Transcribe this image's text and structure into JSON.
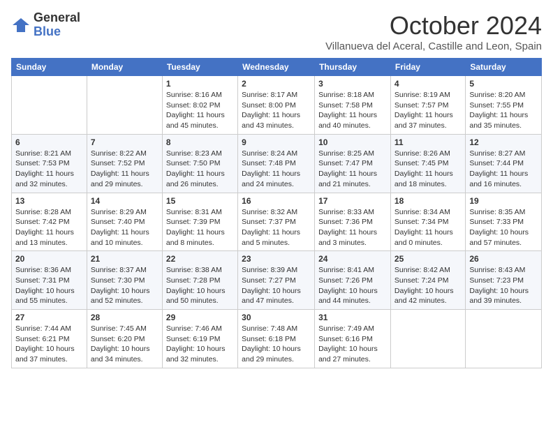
{
  "logo": {
    "general": "General",
    "blue": "Blue"
  },
  "title": "October 2024",
  "location": "Villanueva del Aceral, Castille and Leon, Spain",
  "weekdays": [
    "Sunday",
    "Monday",
    "Tuesday",
    "Wednesday",
    "Thursday",
    "Friday",
    "Saturday"
  ],
  "weeks": [
    [
      {
        "day": "",
        "sunrise": "",
        "sunset": "",
        "daylight": ""
      },
      {
        "day": "",
        "sunrise": "",
        "sunset": "",
        "daylight": ""
      },
      {
        "day": "1",
        "sunrise": "Sunrise: 8:16 AM",
        "sunset": "Sunset: 8:02 PM",
        "daylight": "Daylight: 11 hours and 45 minutes."
      },
      {
        "day": "2",
        "sunrise": "Sunrise: 8:17 AM",
        "sunset": "Sunset: 8:00 PM",
        "daylight": "Daylight: 11 hours and 43 minutes."
      },
      {
        "day": "3",
        "sunrise": "Sunrise: 8:18 AM",
        "sunset": "Sunset: 7:58 PM",
        "daylight": "Daylight: 11 hours and 40 minutes."
      },
      {
        "day": "4",
        "sunrise": "Sunrise: 8:19 AM",
        "sunset": "Sunset: 7:57 PM",
        "daylight": "Daylight: 11 hours and 37 minutes."
      },
      {
        "day": "5",
        "sunrise": "Sunrise: 8:20 AM",
        "sunset": "Sunset: 7:55 PM",
        "daylight": "Daylight: 11 hours and 35 minutes."
      }
    ],
    [
      {
        "day": "6",
        "sunrise": "Sunrise: 8:21 AM",
        "sunset": "Sunset: 7:53 PM",
        "daylight": "Daylight: 11 hours and 32 minutes."
      },
      {
        "day": "7",
        "sunrise": "Sunrise: 8:22 AM",
        "sunset": "Sunset: 7:52 PM",
        "daylight": "Daylight: 11 hours and 29 minutes."
      },
      {
        "day": "8",
        "sunrise": "Sunrise: 8:23 AM",
        "sunset": "Sunset: 7:50 PM",
        "daylight": "Daylight: 11 hours and 26 minutes."
      },
      {
        "day": "9",
        "sunrise": "Sunrise: 8:24 AM",
        "sunset": "Sunset: 7:48 PM",
        "daylight": "Daylight: 11 hours and 24 minutes."
      },
      {
        "day": "10",
        "sunrise": "Sunrise: 8:25 AM",
        "sunset": "Sunset: 7:47 PM",
        "daylight": "Daylight: 11 hours and 21 minutes."
      },
      {
        "day": "11",
        "sunrise": "Sunrise: 8:26 AM",
        "sunset": "Sunset: 7:45 PM",
        "daylight": "Daylight: 11 hours and 18 minutes."
      },
      {
        "day": "12",
        "sunrise": "Sunrise: 8:27 AM",
        "sunset": "Sunset: 7:44 PM",
        "daylight": "Daylight: 11 hours and 16 minutes."
      }
    ],
    [
      {
        "day": "13",
        "sunrise": "Sunrise: 8:28 AM",
        "sunset": "Sunset: 7:42 PM",
        "daylight": "Daylight: 11 hours and 13 minutes."
      },
      {
        "day": "14",
        "sunrise": "Sunrise: 8:29 AM",
        "sunset": "Sunset: 7:40 PM",
        "daylight": "Daylight: 11 hours and 10 minutes."
      },
      {
        "day": "15",
        "sunrise": "Sunrise: 8:31 AM",
        "sunset": "Sunset: 7:39 PM",
        "daylight": "Daylight: 11 hours and 8 minutes."
      },
      {
        "day": "16",
        "sunrise": "Sunrise: 8:32 AM",
        "sunset": "Sunset: 7:37 PM",
        "daylight": "Daylight: 11 hours and 5 minutes."
      },
      {
        "day": "17",
        "sunrise": "Sunrise: 8:33 AM",
        "sunset": "Sunset: 7:36 PM",
        "daylight": "Daylight: 11 hours and 3 minutes."
      },
      {
        "day": "18",
        "sunrise": "Sunrise: 8:34 AM",
        "sunset": "Sunset: 7:34 PM",
        "daylight": "Daylight: 11 hours and 0 minutes."
      },
      {
        "day": "19",
        "sunrise": "Sunrise: 8:35 AM",
        "sunset": "Sunset: 7:33 PM",
        "daylight": "Daylight: 10 hours and 57 minutes."
      }
    ],
    [
      {
        "day": "20",
        "sunrise": "Sunrise: 8:36 AM",
        "sunset": "Sunset: 7:31 PM",
        "daylight": "Daylight: 10 hours and 55 minutes."
      },
      {
        "day": "21",
        "sunrise": "Sunrise: 8:37 AM",
        "sunset": "Sunset: 7:30 PM",
        "daylight": "Daylight: 10 hours and 52 minutes."
      },
      {
        "day": "22",
        "sunrise": "Sunrise: 8:38 AM",
        "sunset": "Sunset: 7:28 PM",
        "daylight": "Daylight: 10 hours and 50 minutes."
      },
      {
        "day": "23",
        "sunrise": "Sunrise: 8:39 AM",
        "sunset": "Sunset: 7:27 PM",
        "daylight": "Daylight: 10 hours and 47 minutes."
      },
      {
        "day": "24",
        "sunrise": "Sunrise: 8:41 AM",
        "sunset": "Sunset: 7:26 PM",
        "daylight": "Daylight: 10 hours and 44 minutes."
      },
      {
        "day": "25",
        "sunrise": "Sunrise: 8:42 AM",
        "sunset": "Sunset: 7:24 PM",
        "daylight": "Daylight: 10 hours and 42 minutes."
      },
      {
        "day": "26",
        "sunrise": "Sunrise: 8:43 AM",
        "sunset": "Sunset: 7:23 PM",
        "daylight": "Daylight: 10 hours and 39 minutes."
      }
    ],
    [
      {
        "day": "27",
        "sunrise": "Sunrise: 7:44 AM",
        "sunset": "Sunset: 6:21 PM",
        "daylight": "Daylight: 10 hours and 37 minutes."
      },
      {
        "day": "28",
        "sunrise": "Sunrise: 7:45 AM",
        "sunset": "Sunset: 6:20 PM",
        "daylight": "Daylight: 10 hours and 34 minutes."
      },
      {
        "day": "29",
        "sunrise": "Sunrise: 7:46 AM",
        "sunset": "Sunset: 6:19 PM",
        "daylight": "Daylight: 10 hours and 32 minutes."
      },
      {
        "day": "30",
        "sunrise": "Sunrise: 7:48 AM",
        "sunset": "Sunset: 6:18 PM",
        "daylight": "Daylight: 10 hours and 29 minutes."
      },
      {
        "day": "31",
        "sunrise": "Sunrise: 7:49 AM",
        "sunset": "Sunset: 6:16 PM",
        "daylight": "Daylight: 10 hours and 27 minutes."
      },
      {
        "day": "",
        "sunrise": "",
        "sunset": "",
        "daylight": ""
      },
      {
        "day": "",
        "sunrise": "",
        "sunset": "",
        "daylight": ""
      }
    ]
  ]
}
